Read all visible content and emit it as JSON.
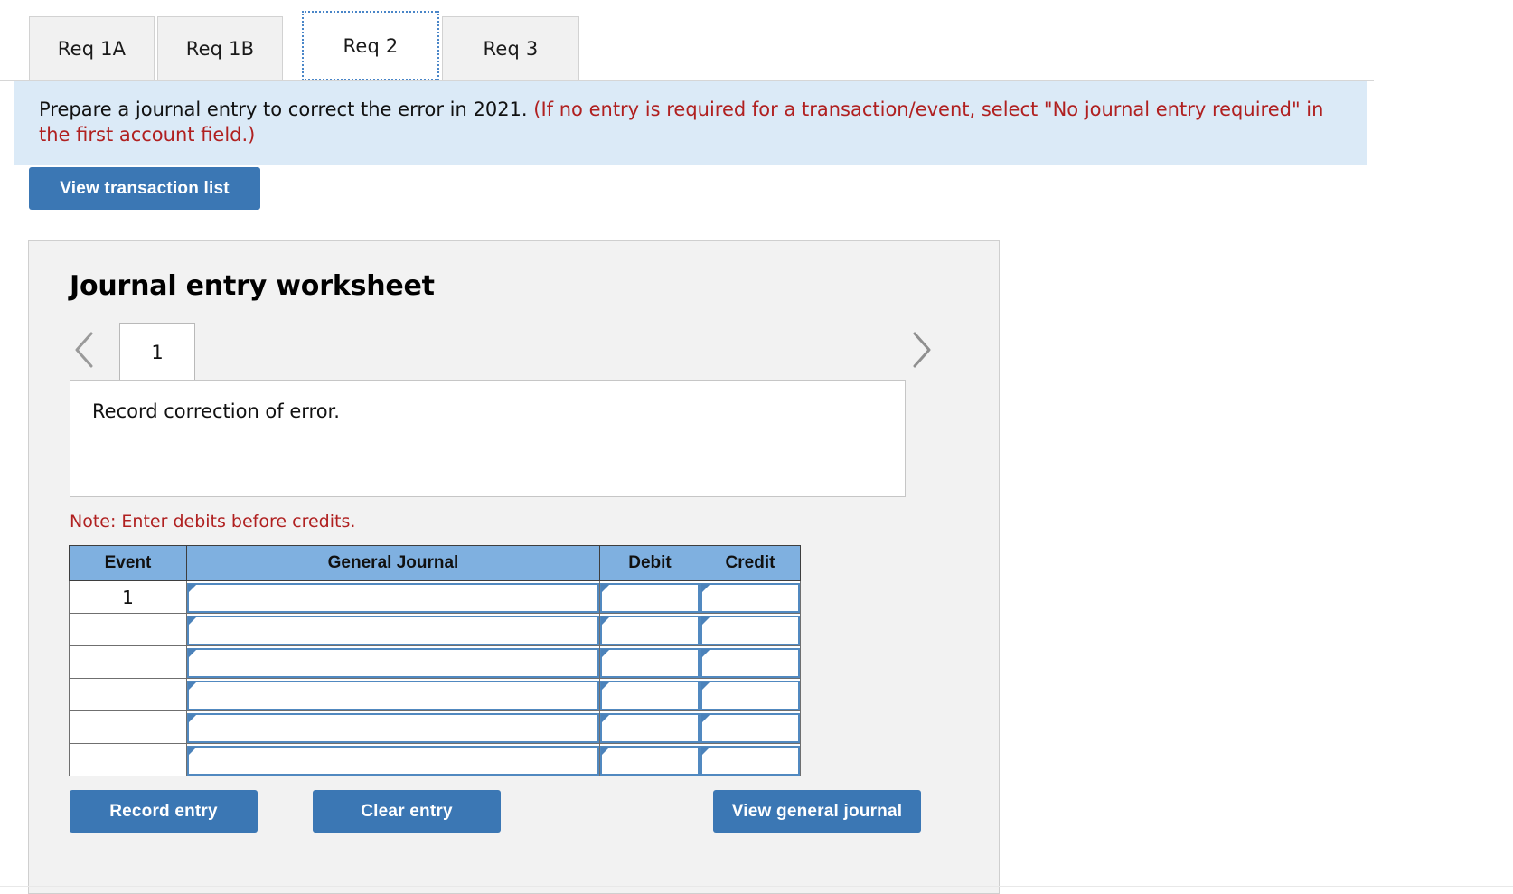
{
  "tabs": [
    {
      "label": "Req 1A",
      "active": false
    },
    {
      "label": "Req 1B",
      "active": false
    },
    {
      "label": "Req 2",
      "active": true
    },
    {
      "label": "Req 3",
      "active": false
    }
  ],
  "banner": {
    "prompt": "Prepare a journal entry to correct the error in 2021.",
    "hint": "(If no entry is required for a transaction/event, select \"No journal entry required\" in the first account field.)"
  },
  "toolbar": {
    "view_transaction_list_label": "View transaction list"
  },
  "worksheet": {
    "title": "Journal entry worksheet",
    "prev_icon": "chevron-left-icon",
    "next_icon": "chevron-right-icon",
    "entry_tabs": [
      {
        "label": "1",
        "active": true
      }
    ],
    "description": "Record correction of error.",
    "note": "Note: Enter debits before credits.",
    "table": {
      "headers": [
        "Event",
        "General Journal",
        "Debit",
        "Credit"
      ],
      "rows": [
        {
          "event": "1",
          "general_journal": "",
          "debit": "",
          "credit": ""
        },
        {
          "event": "",
          "general_journal": "",
          "debit": "",
          "credit": ""
        },
        {
          "event": "",
          "general_journal": "",
          "debit": "",
          "credit": ""
        },
        {
          "event": "",
          "general_journal": "",
          "debit": "",
          "credit": ""
        },
        {
          "event": "",
          "general_journal": "",
          "debit": "",
          "credit": ""
        },
        {
          "event": "",
          "general_journal": "",
          "debit": "",
          "credit": ""
        }
      ]
    },
    "actions": {
      "record_entry_label": "Record entry",
      "clear_entry_label": "Clear entry",
      "view_general_journal_label": "View general journal"
    }
  },
  "colors": {
    "accent_blue": "#3b77b4",
    "banner_bg": "#dbeaf7",
    "table_header_blue": "#7fb0e0",
    "alert_red": "#b02020",
    "card_bg": "#f2f2f2",
    "field_border_blue": "#5189c0"
  }
}
